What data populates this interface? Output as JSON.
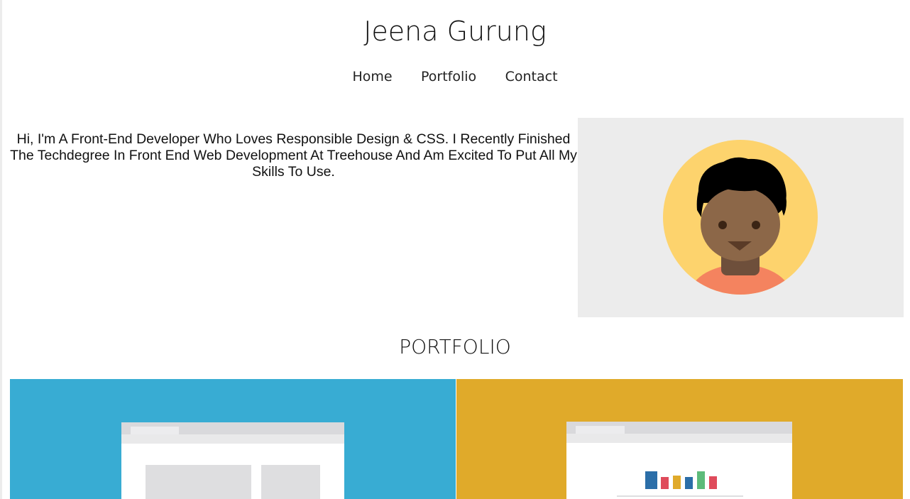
{
  "header": {
    "title": "Jeena Gurung",
    "nav": [
      {
        "label": "Home"
      },
      {
        "label": "Portfolio"
      },
      {
        "label": "Contact"
      }
    ]
  },
  "intro": {
    "text": "Hi, I'm A Front-End Developer Who Loves Responsible Design & CSS. I Recently Finished The Techdegree In Front End Web Development At Treehouse And Am Excited To Put All My Skills To Use."
  },
  "avatar": {
    "icon": "person-avatar-icon"
  },
  "portfolio": {
    "heading": "PORTFOLIO",
    "tiles": [
      {
        "icon": "webpage-layout-icon",
        "color": "#38acd3"
      },
      {
        "icon": "chart-webpage-icon",
        "color": "#e0aa2a"
      }
    ]
  },
  "colors": {
    "avatar_bg": "#ececec",
    "avatar_circle": "#fdd36d",
    "skin": "#8c6748",
    "shirt": "#f4835f"
  }
}
